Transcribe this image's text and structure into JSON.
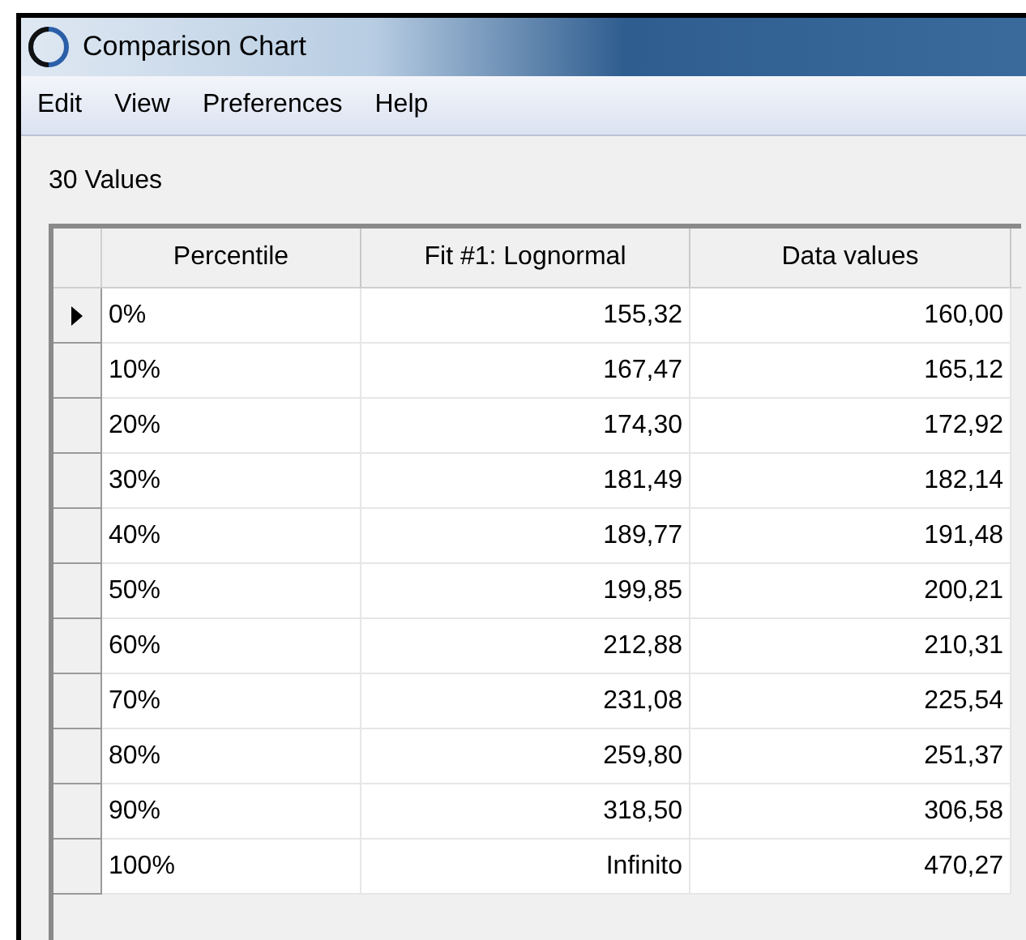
{
  "window": {
    "title": "Comparison Chart"
  },
  "menu": [
    "Edit",
    "View",
    "Preferences",
    "Help"
  ],
  "summary": "30 Values",
  "table": {
    "columns": [
      "Percentile",
      "Fit #1: Lognormal",
      "Data values"
    ],
    "rows": [
      {
        "cells": [
          "0%",
          "155,32",
          "160,00"
        ],
        "selected": true
      },
      {
        "cells": [
          "10%",
          "167,47",
          "165,12"
        ],
        "selected": false
      },
      {
        "cells": [
          "20%",
          "174,30",
          "172,92"
        ],
        "selected": false
      },
      {
        "cells": [
          "30%",
          "181,49",
          "182,14"
        ],
        "selected": false
      },
      {
        "cells": [
          "40%",
          "189,77",
          "191,48"
        ],
        "selected": false
      },
      {
        "cells": [
          "50%",
          "199,85",
          "200,21"
        ],
        "selected": false
      },
      {
        "cells": [
          "60%",
          "212,88",
          "210,31"
        ],
        "selected": false
      },
      {
        "cells": [
          "70%",
          "231,08",
          "225,54"
        ],
        "selected": false
      },
      {
        "cells": [
          "80%",
          "259,80",
          "251,37"
        ],
        "selected": false
      },
      {
        "cells": [
          "90%",
          "318,50",
          "306,58"
        ],
        "selected": false
      },
      {
        "cells": [
          "100%",
          "Infinito",
          "470,27"
        ],
        "selected": false
      }
    ]
  }
}
